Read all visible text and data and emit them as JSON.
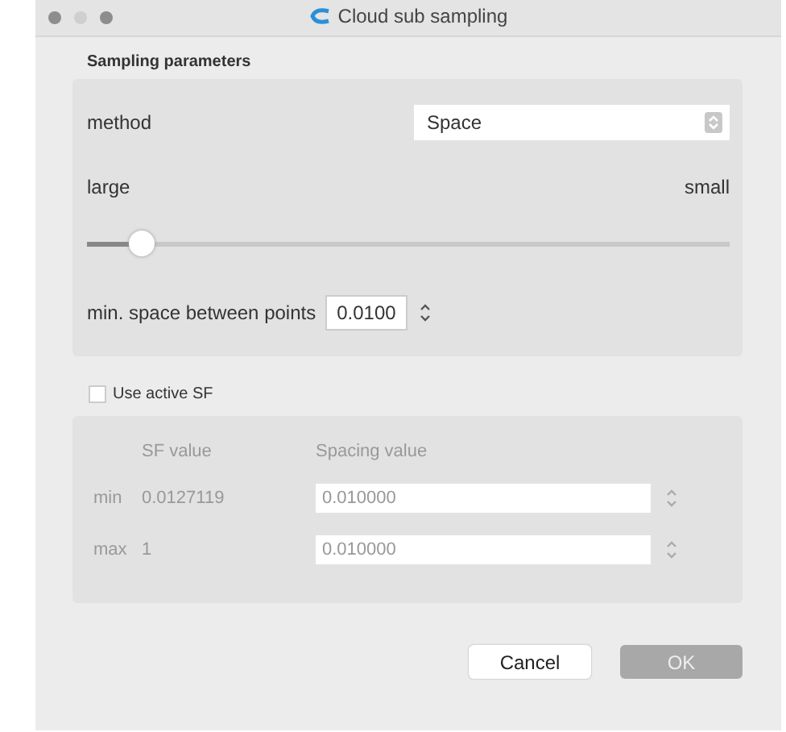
{
  "window": {
    "title": "Cloud sub sampling"
  },
  "sampling": {
    "title": "Sampling parameters",
    "method_label": "method",
    "method_value": "Space",
    "low_label": "large",
    "high_label": "small",
    "slider": {
      "level": 0.07
    },
    "spacing_label": "min. space between points",
    "spacing_value": "0.0100"
  },
  "sf": {
    "label": "Use active SF",
    "checked": false,
    "disabled": true,
    "headers": [
      "SF value",
      "Spacing value"
    ],
    "rows": [
      {
        "label": "min",
        "sf_value": "0.0127119",
        "spacing": "0.010000"
      },
      {
        "label": "max",
        "sf_value": "1",
        "spacing": "0.010000"
      }
    ]
  },
  "buttons": [
    {
      "label": "Cancel",
      "kind": "normal",
      "disabled": false
    },
    {
      "label": "OK",
      "kind": "default",
      "disabled": true
    }
  ]
}
